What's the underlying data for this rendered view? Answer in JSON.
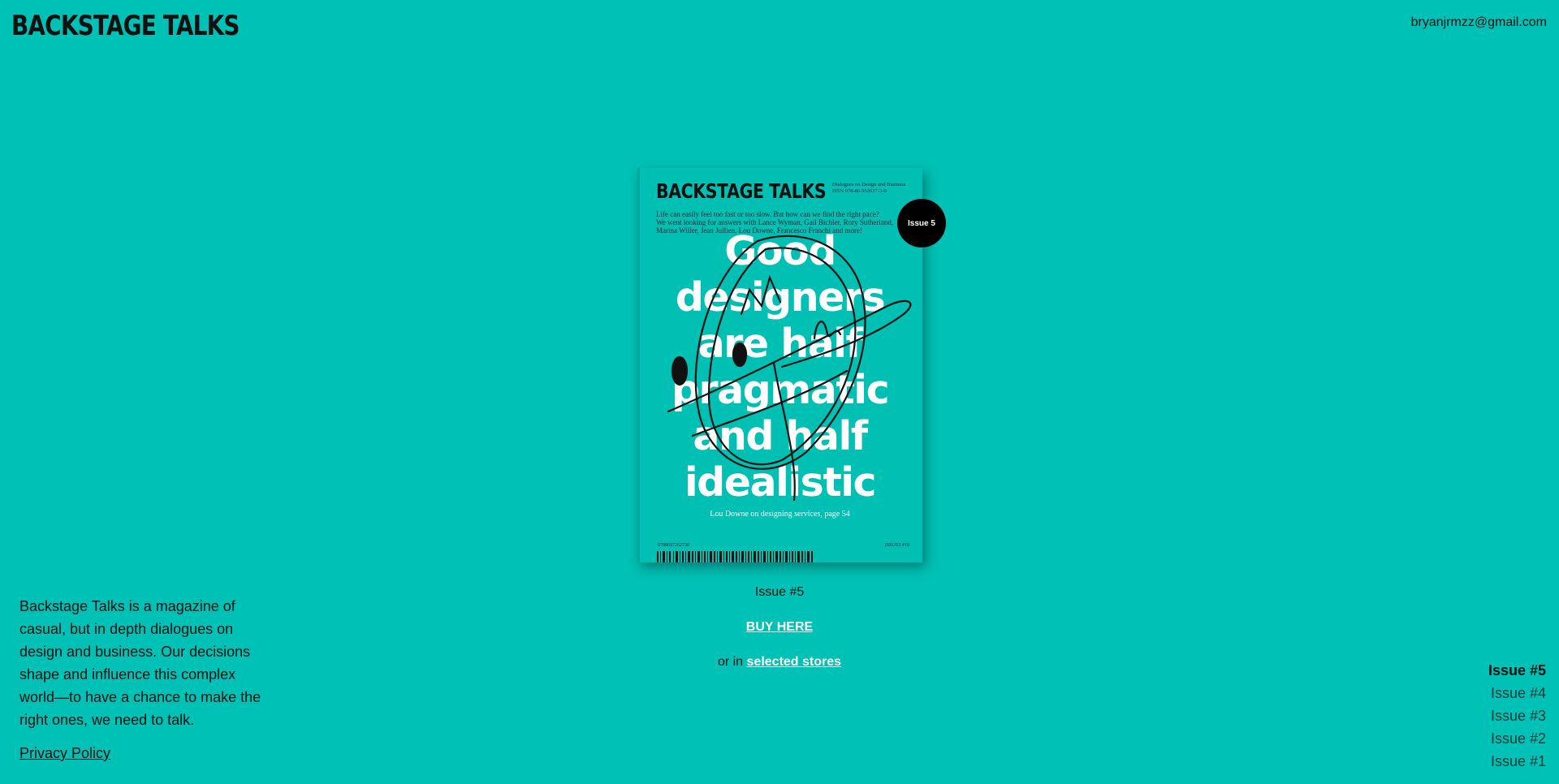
{
  "header": {
    "logo": "BACKSTAGE TALKS",
    "email": "bryanjrmzz@gmail.com"
  },
  "cover": {
    "title": "BACKSTAGE TALKS",
    "meta_line1": "Dialogues on Design and Business",
    "meta_line2": "ISSN 978-86-952637-3-0",
    "blurb_line1": "Life can easily feel too fast or too slow. But how can we find the right pace?",
    "blurb_line2": "We went looking for answers with Lance Wyman, Gail Bichler, Rory Sutherland,",
    "blurb_line3": "Marina Willer, Jean Jullien, Lou Downe, Francesco Franchi and more!",
    "headline": [
      "Good",
      "designers",
      "are half",
      "pragmatic",
      "and half",
      "idealistic"
    ],
    "subline": "Lou Downe on designing services, page 54",
    "isbn_code": "9788697262730",
    "issue_code": "ISSUE5 #18"
  },
  "badge": {
    "label": "Issue 5"
  },
  "current_issue": {
    "label": "Issue #5"
  },
  "buy": {
    "label": "BUY HERE"
  },
  "stores": {
    "prefix": "or in",
    "link_label": "selected stores"
  },
  "about": {
    "text": "Backstage Talks is a magazine of casual, but in depth dialogues on design and business. Our decisions shape and influence this complex world—to have a chance to make the right ones, we need to talk."
  },
  "footer": {
    "privacy_label": "Privacy Policy"
  },
  "issue_nav": {
    "items": [
      {
        "label": "Issue #5",
        "active": true
      },
      {
        "label": "Issue #4",
        "active": false
      },
      {
        "label": "Issue #3",
        "active": false
      },
      {
        "label": "Issue #2",
        "active": false
      },
      {
        "label": "Issue #1",
        "active": false
      }
    ]
  },
  "colors": {
    "background": "#00C1B5",
    "text": "#111111",
    "link": "#FFFFFF",
    "badge": "#000000"
  }
}
